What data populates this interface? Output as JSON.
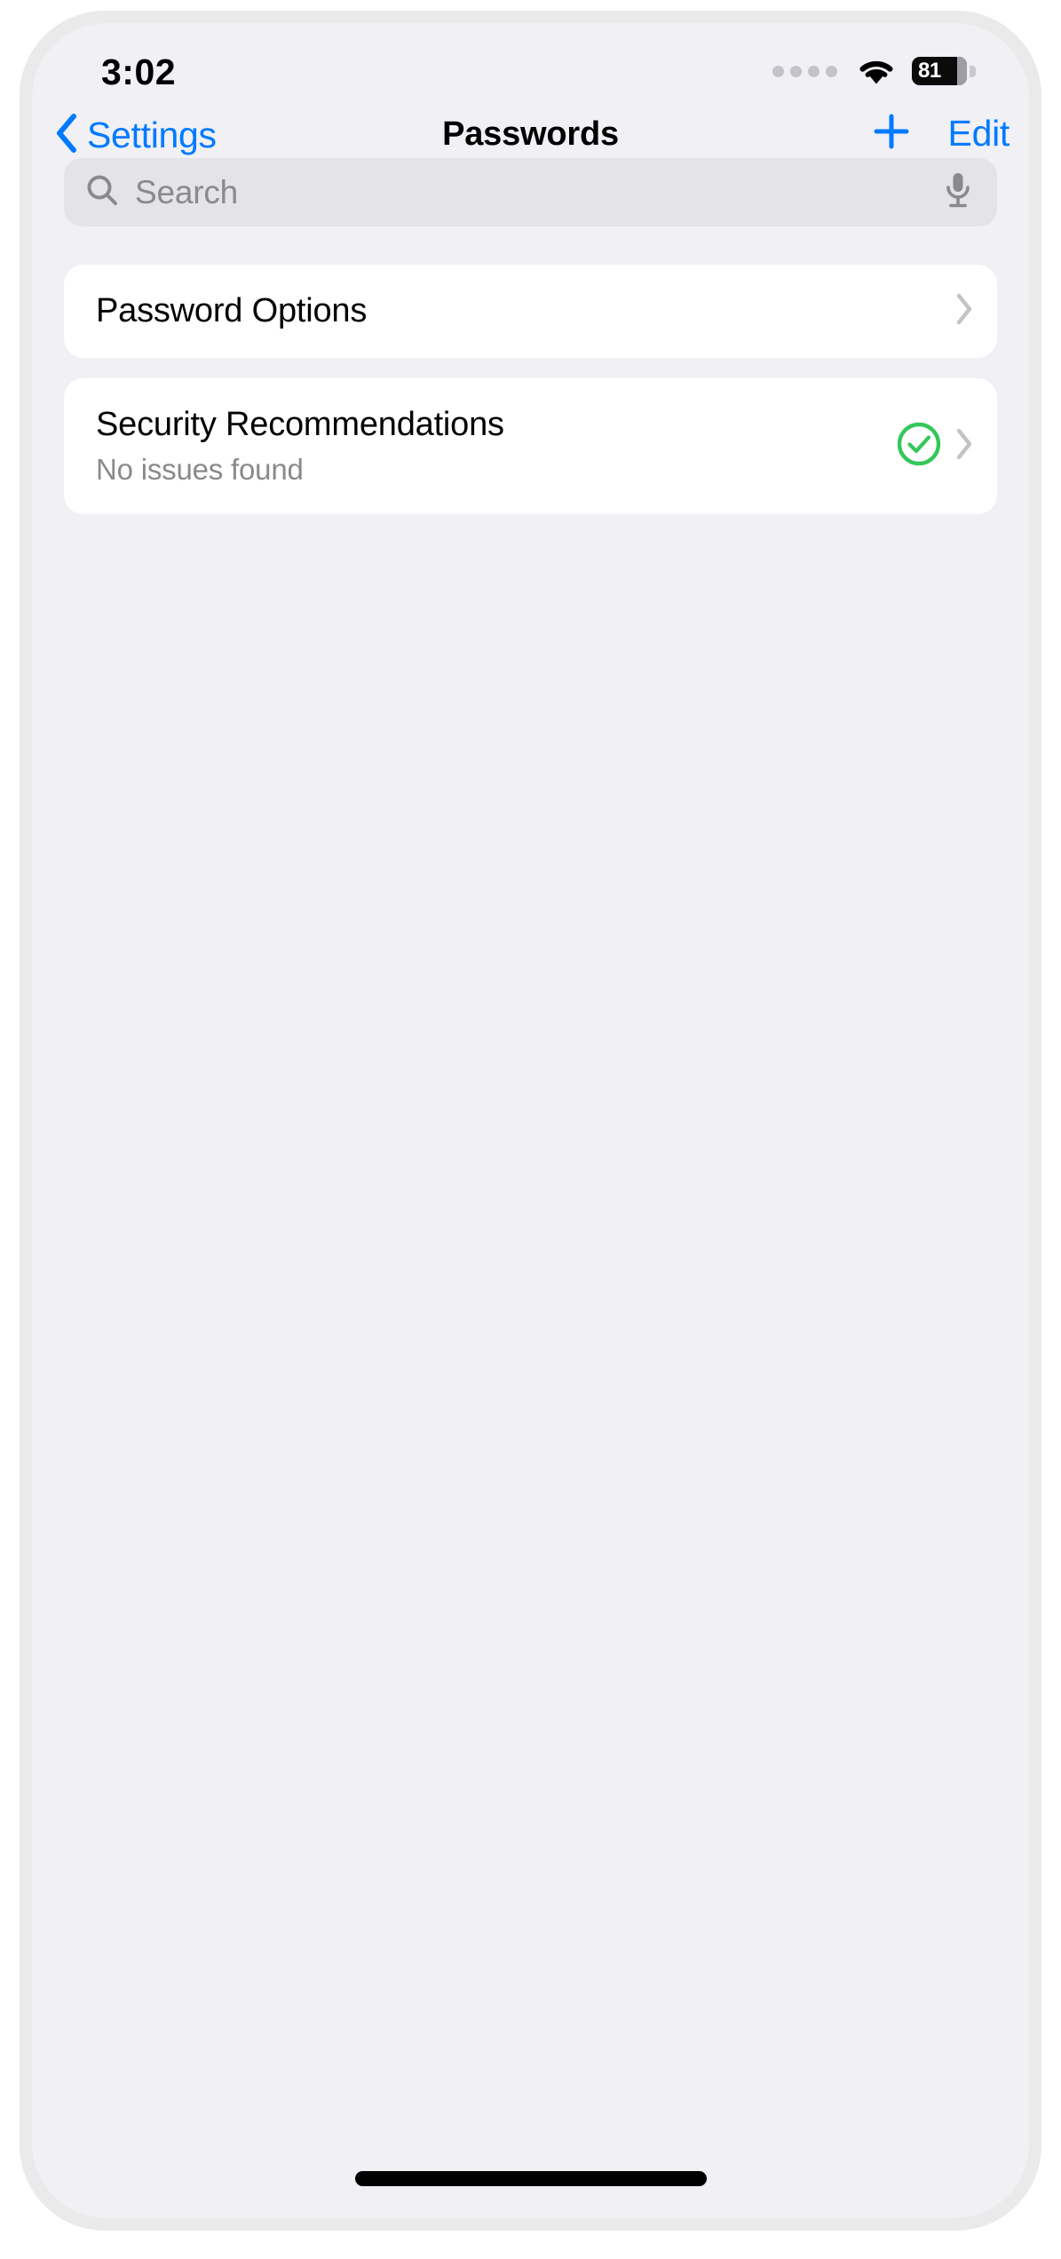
{
  "status_bar": {
    "time": "3:02",
    "signal_dots_icon": "signal-dots-icon",
    "wifi_icon": "wifi-icon",
    "battery_icon": "battery-icon",
    "battery_level": "81"
  },
  "nav_bar": {
    "back_chevron_icon": "chevron-left-icon",
    "back_label": "Settings",
    "title": "Passwords",
    "add_icon": "plus-icon",
    "edit_label": "Edit"
  },
  "search": {
    "search_icon": "search-icon",
    "placeholder": "Search",
    "value": "",
    "mic_icon": "microphone-icon"
  },
  "list": {
    "password_options": {
      "title": "Password Options",
      "chevron_icon": "chevron-right-icon"
    },
    "security_recommendations": {
      "title": "Security Recommendations",
      "subtitle": "No issues found",
      "status_icon": "checkmark-circle-icon",
      "chevron_icon": "chevron-right-icon"
    }
  },
  "home_indicator": "home-indicator",
  "colors": {
    "accent_blue": "#007aff",
    "success_green": "#34c759",
    "screen_background": "#f0f0f5",
    "card_background": "#ffffff",
    "secondary_text": "#8a8a8e",
    "search_field": "#e3e3e8",
    "device_bezel": "#eaeaea"
  }
}
